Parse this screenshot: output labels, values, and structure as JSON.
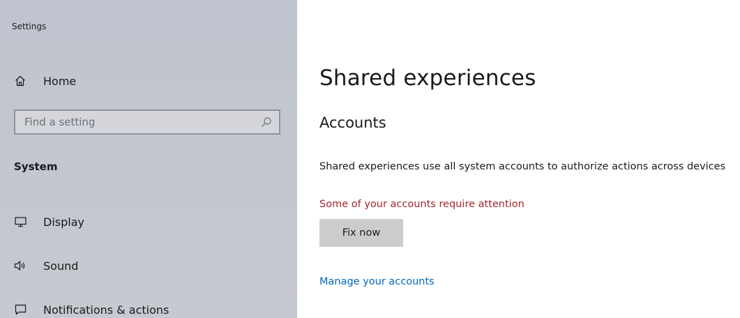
{
  "window": {
    "app_title": "Settings"
  },
  "sidebar": {
    "home": {
      "label": "Home",
      "icon": "home-icon"
    },
    "search": {
      "placeholder": "Find a setting",
      "value": "",
      "icon": "search-icon"
    },
    "section_heading": "System",
    "items": [
      {
        "label": "Display",
        "icon": "display-icon"
      },
      {
        "label": "Sound",
        "icon": "sound-icon"
      },
      {
        "label": "Notifications & actions",
        "icon": "notifications-icon"
      }
    ]
  },
  "main": {
    "page_title": "Shared experiences",
    "section_title": "Accounts",
    "description": "Shared experiences use all system accounts to authorize actions across devices",
    "warning": "Some of your accounts require attention",
    "fix_button_label": "Fix now",
    "manage_link_label": "Manage your accounts"
  },
  "colors": {
    "sidebar_bg": "#c3c6cf",
    "warning_text": "#a4262c",
    "link_text": "#0067b8",
    "button_bg": "#cccccc"
  }
}
